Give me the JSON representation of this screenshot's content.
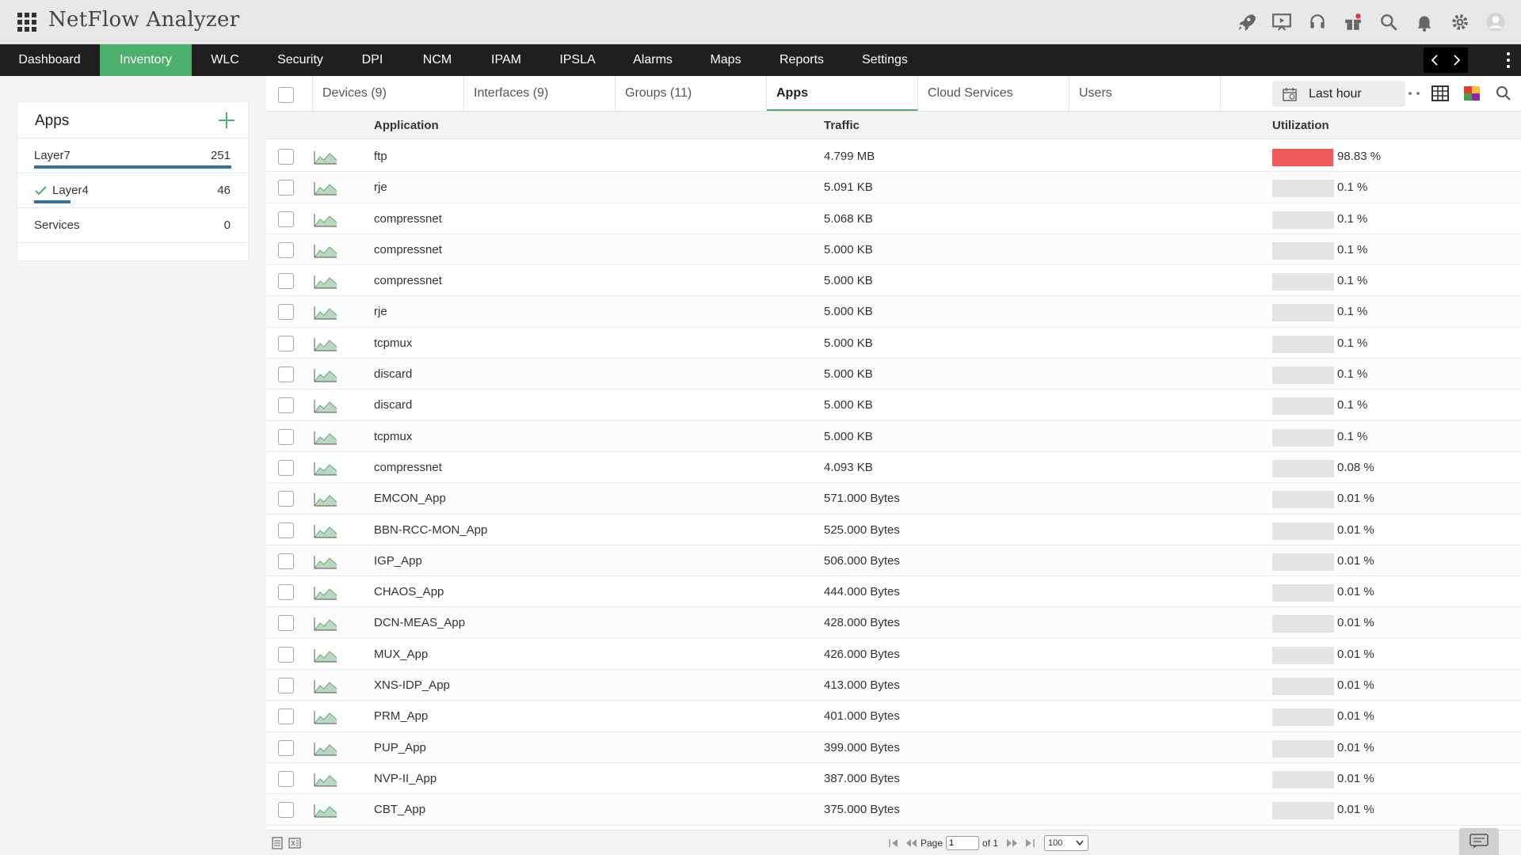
{
  "app": {
    "title": "NetFlow Analyzer"
  },
  "top_icons": [
    "rocket-icon",
    "presentation-icon",
    "headset-icon",
    "gift-icon",
    "search-icon",
    "bell-icon",
    "gear-icon",
    "user-avatar-icon"
  ],
  "nav": {
    "items": [
      {
        "label": "Dashboard"
      },
      {
        "label": "Inventory",
        "active": true
      },
      {
        "label": "WLC"
      },
      {
        "label": "Security"
      },
      {
        "label": "DPI"
      },
      {
        "label": "NCM"
      },
      {
        "label": "IPAM"
      },
      {
        "label": "IPSLA"
      },
      {
        "label": "Alarms"
      },
      {
        "label": "Maps"
      },
      {
        "label": "Reports"
      },
      {
        "label": "Settings"
      }
    ]
  },
  "sidebar": {
    "title": "Apps",
    "items": [
      {
        "label": "Layer7",
        "count": "251",
        "bar_fraction": 1.0
      },
      {
        "label": "Layer4",
        "count": "46",
        "bar_fraction": 0.183,
        "selected": true
      },
      {
        "label": "Services",
        "count": "0",
        "bar_fraction": 0
      }
    ]
  },
  "tabs": [
    {
      "label": "Devices (9)"
    },
    {
      "label": "Interfaces (9)"
    },
    {
      "label": "Groups (11)"
    },
    {
      "label": "Apps",
      "active": true
    },
    {
      "label": "Cloud Services"
    },
    {
      "label": "Users"
    }
  ],
  "time_range": {
    "label": "Last hour"
  },
  "table": {
    "columns": {
      "application": "Application",
      "traffic": "Traffic",
      "utilization": "Utilization"
    },
    "rows": [
      {
        "app": "ftp",
        "traffic": "4.799 MB",
        "utilization": "98.83 %",
        "util_value": 98.83
      },
      {
        "app": "rje",
        "traffic": "5.091 KB",
        "utilization": "0.1 %",
        "util_value": 0.1
      },
      {
        "app": "compressnet",
        "traffic": "5.068 KB",
        "utilization": "0.1 %",
        "util_value": 0.1
      },
      {
        "app": "compressnet",
        "traffic": "5.000 KB",
        "utilization": "0.1 %",
        "util_value": 0.1
      },
      {
        "app": "compressnet",
        "traffic": "5.000 KB",
        "utilization": "0.1 %",
        "util_value": 0.1
      },
      {
        "app": "rje",
        "traffic": "5.000 KB",
        "utilization": "0.1 %",
        "util_value": 0.1
      },
      {
        "app": "tcpmux",
        "traffic": "5.000 KB",
        "utilization": "0.1 %",
        "util_value": 0.1
      },
      {
        "app": "discard",
        "traffic": "5.000 KB",
        "utilization": "0.1 %",
        "util_value": 0.1
      },
      {
        "app": "discard",
        "traffic": "5.000 KB",
        "utilization": "0.1 %",
        "util_value": 0.1
      },
      {
        "app": "tcpmux",
        "traffic": "5.000 KB",
        "utilization": "0.1 %",
        "util_value": 0.1
      },
      {
        "app": "compressnet",
        "traffic": "4.093 KB",
        "utilization": "0.08 %",
        "util_value": 0.08
      },
      {
        "app": "EMCON_App",
        "traffic": "571.000 Bytes",
        "utilization": "0.01 %",
        "util_value": 0.01
      },
      {
        "app": "BBN-RCC-MON_App",
        "traffic": "525.000 Bytes",
        "utilization": "0.01 %",
        "util_value": 0.01
      },
      {
        "app": "IGP_App",
        "traffic": "506.000 Bytes",
        "utilization": "0.01 %",
        "util_value": 0.01
      },
      {
        "app": "CHAOS_App",
        "traffic": "444.000 Bytes",
        "utilization": "0.01 %",
        "util_value": 0.01
      },
      {
        "app": "DCN-MEAS_App",
        "traffic": "428.000 Bytes",
        "utilization": "0.01 %",
        "util_value": 0.01
      },
      {
        "app": "MUX_App",
        "traffic": "426.000 Bytes",
        "utilization": "0.01 %",
        "util_value": 0.01
      },
      {
        "app": "XNS-IDP_App",
        "traffic": "413.000 Bytes",
        "utilization": "0.01 %",
        "util_value": 0.01
      },
      {
        "app": "PRM_App",
        "traffic": "401.000 Bytes",
        "utilization": "0.01 %",
        "util_value": 0.01
      },
      {
        "app": "PUP_App",
        "traffic": "399.000 Bytes",
        "utilization": "0.01 %",
        "util_value": 0.01
      },
      {
        "app": "NVP-II_App",
        "traffic": "387.000 Bytes",
        "utilization": "0.01 %",
        "util_value": 0.01
      },
      {
        "app": "CBT_App",
        "traffic": "375.000 Bytes",
        "utilization": "0.01 %",
        "util_value": 0.01
      }
    ]
  },
  "pagination": {
    "page_label": "Page",
    "page_value": "1",
    "of_label": "of 1",
    "page_size": "100"
  },
  "colors": {
    "accent": "#4caf6e",
    "nav_bg": "#1f1f1f",
    "util_high": "#f25a5a",
    "bar_blue": "#2f73a8"
  }
}
